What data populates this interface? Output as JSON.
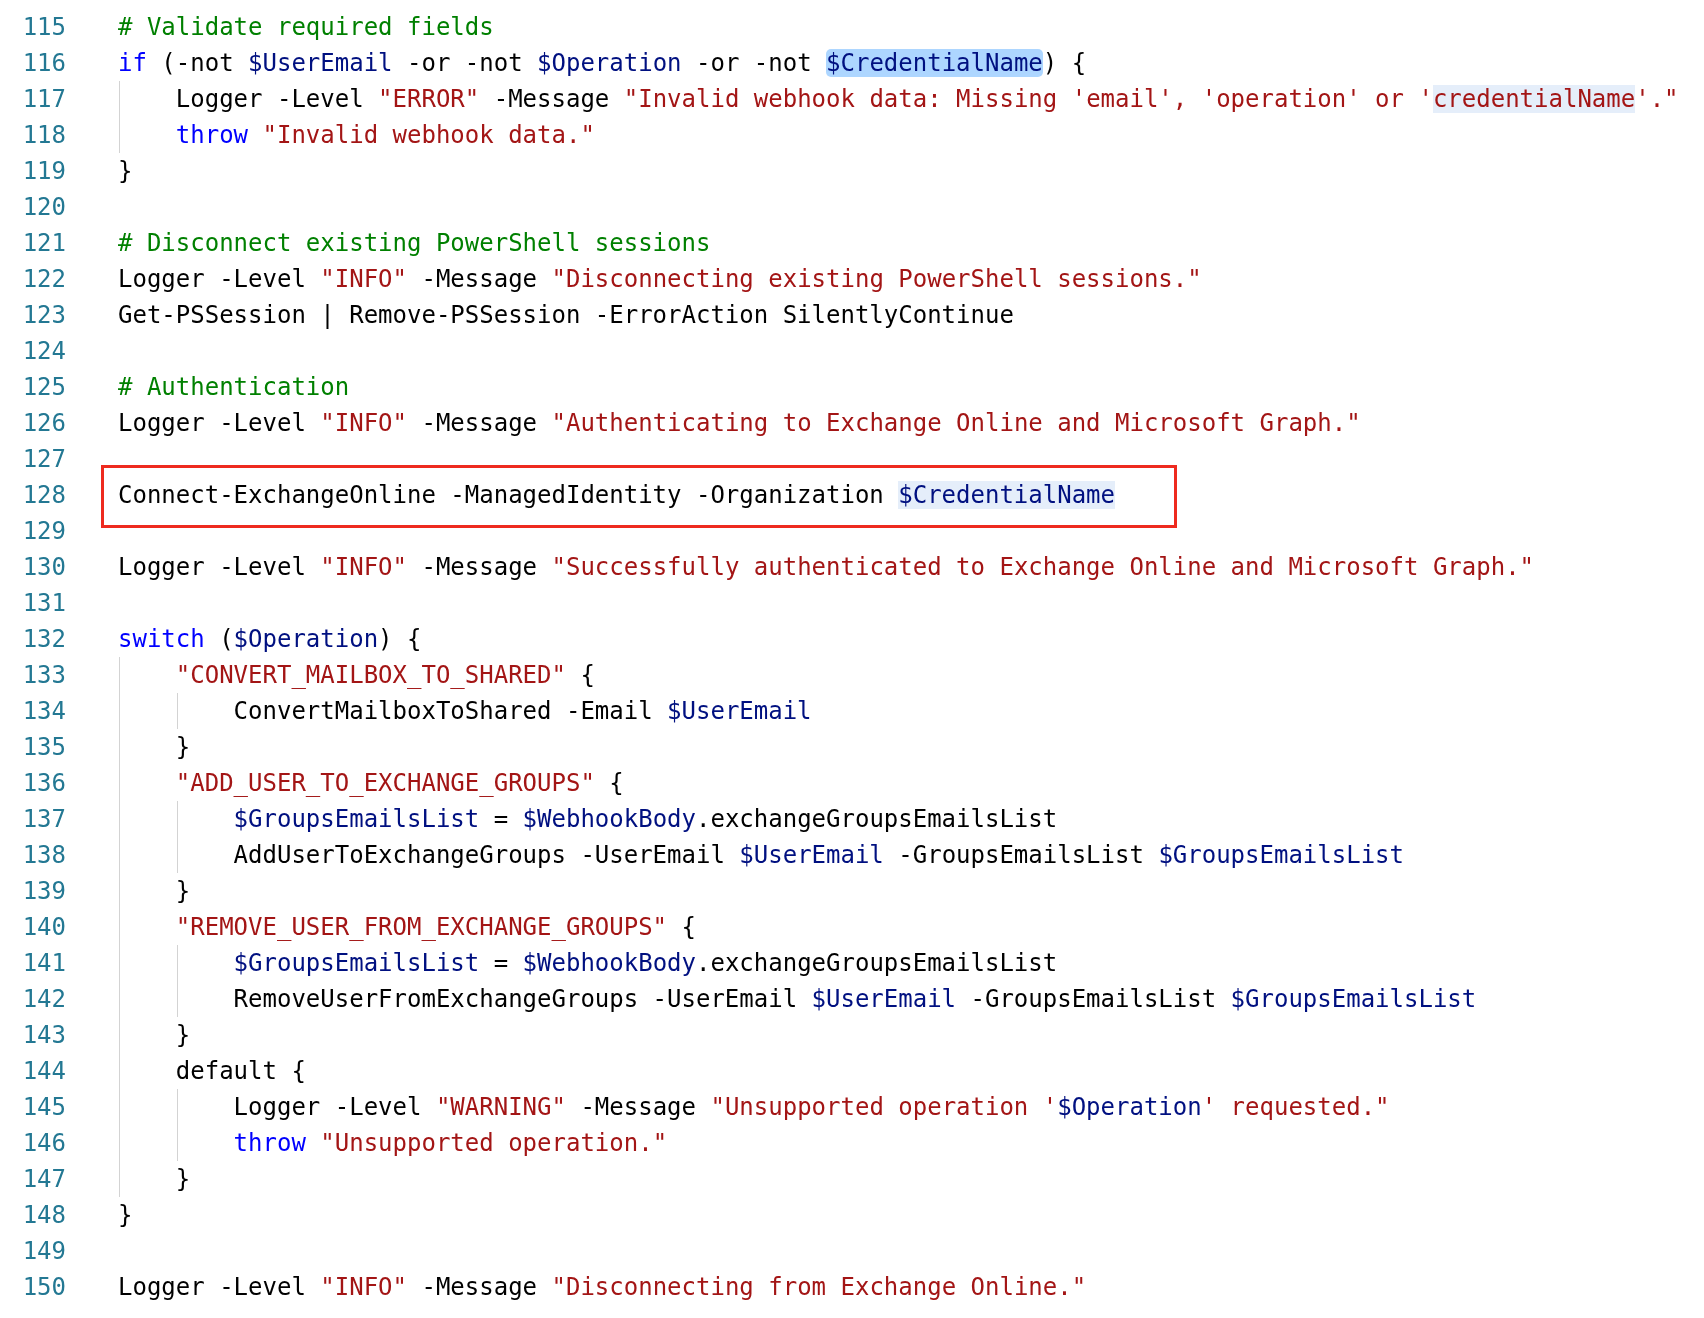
{
  "editor": {
    "lines": [
      {
        "number": "115",
        "boxed": false,
        "tokens": [
          {
            "kind": "comment",
            "text": "# Validate required fields"
          }
        ]
      },
      {
        "number": "116",
        "boxed": false,
        "tokens": [
          {
            "kind": "keyword",
            "text": "if"
          },
          {
            "kind": "plain",
            "text": " (-not "
          },
          {
            "kind": "variable",
            "text": "$UserEmail"
          },
          {
            "kind": "plain",
            "text": " -or -not "
          },
          {
            "kind": "variable",
            "text": "$Operation"
          },
          {
            "kind": "plain",
            "text": " -or -not "
          },
          {
            "kind": "variable",
            "text": "$CredentialName",
            "selected": true
          },
          {
            "kind": "plain",
            "text": ") {"
          }
        ]
      },
      {
        "number": "117",
        "boxed": false,
        "tokens": [
          {
            "kind": "plain",
            "text": "    Logger -Level "
          },
          {
            "kind": "string",
            "text": "\"ERROR\""
          },
          {
            "kind": "plain",
            "text": " -Message "
          },
          {
            "kind": "string",
            "text": "\"Invalid webhook data: Missing 'email', 'operation' or '"
          },
          {
            "kind": "string",
            "text": "credentialName",
            "highlighted": true
          },
          {
            "kind": "string",
            "text": "'.\""
          }
        ]
      },
      {
        "number": "118",
        "boxed": false,
        "tokens": [
          {
            "kind": "keyword",
            "text": "    throw"
          },
          {
            "kind": "string",
            "text": " \"Invalid webhook data.\""
          }
        ]
      },
      {
        "number": "119",
        "boxed": false,
        "tokens": [
          {
            "kind": "plain",
            "text": "}"
          }
        ]
      },
      {
        "number": "120",
        "boxed": false
      },
      {
        "number": "121",
        "boxed": false,
        "tokens": [
          {
            "kind": "comment",
            "text": "# Disconnect existing PowerShell sessions"
          }
        ]
      },
      {
        "number": "122",
        "boxed": false,
        "tokens": [
          {
            "kind": "plain",
            "text": "Logger -Level "
          },
          {
            "kind": "string",
            "text": "\"INFO\""
          },
          {
            "kind": "plain",
            "text": " -Message "
          },
          {
            "kind": "string",
            "text": "\"Disconnecting existing PowerShell sessions.\""
          }
        ]
      },
      {
        "number": "123",
        "boxed": false,
        "tokens": [
          {
            "kind": "plain",
            "text": "Get-PSSession | Remove-PSSession -ErrorAction SilentlyContinue"
          }
        ]
      },
      {
        "number": "124",
        "boxed": false
      },
      {
        "number": "125",
        "boxed": false,
        "tokens": [
          {
            "kind": "comment",
            "text": "# Authentication"
          }
        ]
      },
      {
        "number": "126",
        "boxed": false,
        "tokens": [
          {
            "kind": "plain",
            "text": "Logger -Level "
          },
          {
            "kind": "string",
            "text": "\"INFO\""
          },
          {
            "kind": "plain",
            "text": " -Message "
          },
          {
            "kind": "string",
            "text": "\"Authenticating to Exchange Online and Microsoft Graph.\""
          }
        ]
      },
      {
        "number": "127",
        "boxed": false
      },
      {
        "number": "128",
        "boxed": true,
        "tokens": [
          {
            "kind": "plain",
            "text": "Connect-ExchangeOnline -ManagedIdentity -Organization "
          },
          {
            "kind": "variable",
            "text": "$CredentialName",
            "highlighted": true
          }
        ]
      },
      {
        "number": "129",
        "boxed": false
      },
      {
        "number": "130",
        "boxed": false,
        "tokens": [
          {
            "kind": "plain",
            "text": "Logger -Level "
          },
          {
            "kind": "string",
            "text": "\"INFO\""
          },
          {
            "kind": "plain",
            "text": " -Message "
          },
          {
            "kind": "string",
            "text": "\"Successfully authenticated to Exchange Online and Microsoft Graph.\""
          }
        ]
      },
      {
        "number": "131",
        "boxed": false
      },
      {
        "number": "132",
        "boxed": false,
        "tokens": [
          {
            "kind": "keyword",
            "text": "switch"
          },
          {
            "kind": "plain",
            "text": " ("
          },
          {
            "kind": "variable",
            "text": "$Operation"
          },
          {
            "kind": "plain",
            "text": ") {"
          }
        ]
      },
      {
        "number": "133",
        "boxed": false,
        "tokens": [
          {
            "kind": "string",
            "text": "    \"CONVERT_MAILBOX_TO_SHARED\""
          },
          {
            "kind": "plain",
            "text": " {"
          }
        ]
      },
      {
        "number": "134",
        "boxed": false,
        "tokens": [
          {
            "kind": "plain",
            "text": "        ConvertMailboxToShared -Email "
          },
          {
            "kind": "variable",
            "text": "$UserEmail"
          }
        ]
      },
      {
        "number": "135",
        "boxed": false,
        "tokens": [
          {
            "kind": "plain",
            "text": "    }"
          }
        ]
      },
      {
        "number": "136",
        "boxed": false,
        "tokens": [
          {
            "kind": "string",
            "text": "    \"ADD_USER_TO_EXCHANGE_GROUPS\""
          },
          {
            "kind": "plain",
            "text": " {"
          }
        ]
      },
      {
        "number": "137",
        "boxed": false,
        "tokens": [
          {
            "kind": "variable",
            "text": "        $GroupsEmailsList"
          },
          {
            "kind": "plain",
            "text": " = "
          },
          {
            "kind": "variable",
            "text": "$WebhookBody"
          },
          {
            "kind": "plain",
            "text": ".exchangeGroupsEmailsList"
          }
        ]
      },
      {
        "number": "138",
        "boxed": false,
        "tokens": [
          {
            "kind": "plain",
            "text": "        AddUserToExchangeGroups -UserEmail "
          },
          {
            "kind": "variable",
            "text": "$UserEmail"
          },
          {
            "kind": "plain",
            "text": " -GroupsEmailsList "
          },
          {
            "kind": "variable",
            "text": "$GroupsEmailsList"
          }
        ]
      },
      {
        "number": "139",
        "boxed": false,
        "tokens": [
          {
            "kind": "plain",
            "text": "    }"
          }
        ]
      },
      {
        "number": "140",
        "boxed": false,
        "tokens": [
          {
            "kind": "string",
            "text": "    \"REMOVE_USER_FROM_EXCHANGE_GROUPS\""
          },
          {
            "kind": "plain",
            "text": " {"
          }
        ]
      },
      {
        "number": "141",
        "boxed": false,
        "tokens": [
          {
            "kind": "variable",
            "text": "        $GroupsEmailsList"
          },
          {
            "kind": "plain",
            "text": " = "
          },
          {
            "kind": "variable",
            "text": "$WebhookBody"
          },
          {
            "kind": "plain",
            "text": ".exchangeGroupsEmailsList"
          }
        ]
      },
      {
        "number": "142",
        "boxed": false,
        "tokens": [
          {
            "kind": "plain",
            "text": "        RemoveUserFromExchangeGroups -UserEmail "
          },
          {
            "kind": "variable",
            "text": "$UserEmail"
          },
          {
            "kind": "plain",
            "text": " -GroupsEmailsList "
          },
          {
            "kind": "variable",
            "text": "$GroupsEmailsList"
          }
        ]
      },
      {
        "number": "143",
        "boxed": false,
        "tokens": [
          {
            "kind": "plain",
            "text": "    }"
          }
        ]
      },
      {
        "number": "144",
        "boxed": false,
        "tokens": [
          {
            "kind": "plain",
            "text": "    default {"
          }
        ]
      },
      {
        "number": "145",
        "boxed": false,
        "tokens": [
          {
            "kind": "plain",
            "text": "        Logger -Level "
          },
          {
            "kind": "string",
            "text": "\"WARNING\""
          },
          {
            "kind": "plain",
            "text": " -Message "
          },
          {
            "kind": "string",
            "text": "\"Unsupported operation '"
          },
          {
            "kind": "variable",
            "text": "$Operation"
          },
          {
            "kind": "string",
            "text": "' requested.\""
          }
        ]
      },
      {
        "number": "146",
        "boxed": false,
        "tokens": [
          {
            "kind": "keyword",
            "text": "        throw"
          },
          {
            "kind": "string",
            "text": " \"Unsupported operation.\""
          }
        ]
      },
      {
        "number": "147",
        "boxed": false,
        "tokens": [
          {
            "kind": "plain",
            "text": "    }"
          }
        ]
      },
      {
        "number": "148",
        "boxed": false,
        "tokens": [
          {
            "kind": "plain",
            "text": "}"
          }
        ]
      },
      {
        "number": "149",
        "boxed": false
      },
      {
        "number": "150",
        "boxed": false,
        "tokens": [
          {
            "kind": "plain",
            "text": "Logger -Level "
          },
          {
            "kind": "string",
            "text": "\"INFO\""
          },
          {
            "kind": "plain",
            "text": " -Message "
          },
          {
            "kind": "string",
            "text": "\"Disconnecting from Exchange Online.\""
          }
        ]
      }
    ]
  }
}
